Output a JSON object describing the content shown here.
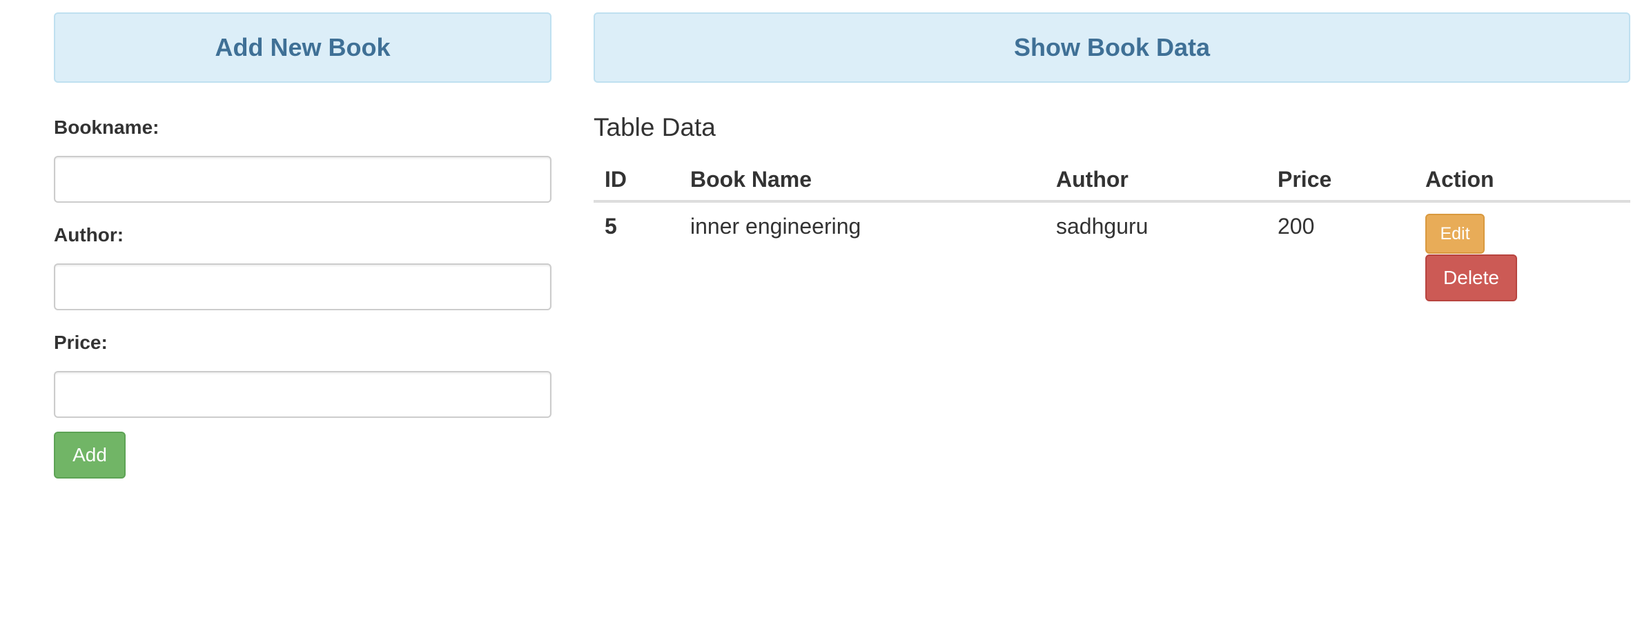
{
  "add_panel": {
    "heading": "Add New Book",
    "fields": {
      "bookname": {
        "label": "Bookname:",
        "value": "",
        "placeholder": ""
      },
      "author": {
        "label": "Author:",
        "value": "",
        "placeholder": ""
      },
      "price": {
        "label": "Price:",
        "value": "",
        "placeholder": ""
      }
    },
    "add_button": "Add"
  },
  "show_panel": {
    "heading": "Show Book Data",
    "table_title": "Table Data",
    "columns": [
      "ID",
      "Book Name",
      "Author",
      "Price",
      "Action"
    ],
    "rows": [
      {
        "id": "5",
        "book_name": "inner engineering",
        "author": "sadhguru",
        "price": "200",
        "edit_label": "Edit",
        "delete_label": "Delete"
      }
    ]
  },
  "colors": {
    "heading_bg": "#dceef8",
    "heading_text": "#3f7096",
    "add_button": "#71b566",
    "edit_button": "#e8ac58",
    "delete_button": "#cc5a55"
  }
}
